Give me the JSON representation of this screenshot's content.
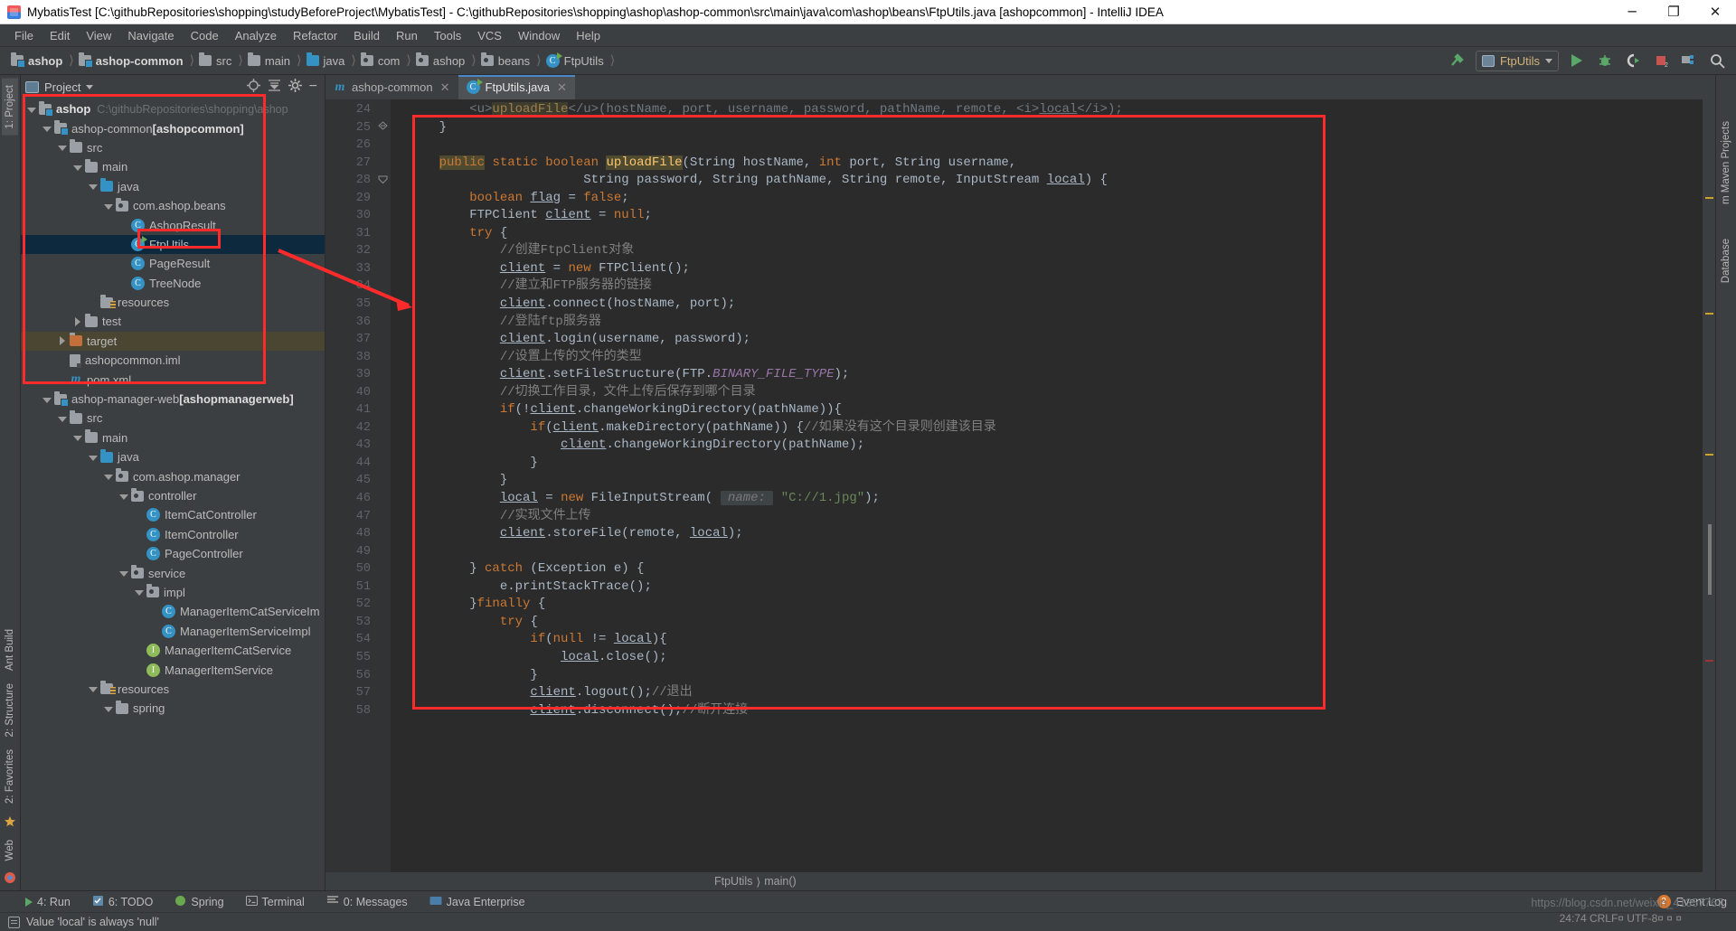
{
  "window": {
    "title": "MybatisTest [C:\\githubRepositories\\shopping\\studyBeforeProject\\MybatisTest] - C:\\githubRepositories\\shopping\\ashop\\ashop-common\\src\\main\\java\\com\\ashop\\beans\\FtpUtils.java [ashopcommon] - IntelliJ IDEA",
    "minimize": "─",
    "maximize": "❐",
    "close": "✕"
  },
  "menu": [
    "File",
    "Edit",
    "View",
    "Navigate",
    "Code",
    "Analyze",
    "Refactor",
    "Build",
    "Run",
    "Tools",
    "VCS",
    "Window",
    "Help"
  ],
  "navbar": {
    "crumbs": [
      {
        "label": "ashop",
        "icon": "module-folder-icon",
        "bold": true
      },
      {
        "label": "ashop-common",
        "icon": "module-folder-icon",
        "bold": true
      },
      {
        "label": "src",
        "icon": "folder-icon",
        "bold": false
      },
      {
        "label": "main",
        "icon": "folder-icon",
        "bold": false
      },
      {
        "label": "java",
        "icon": "source-folder-icon",
        "bold": false
      },
      {
        "label": "com",
        "icon": "package-icon",
        "bold": false
      },
      {
        "label": "ashop",
        "icon": "package-icon",
        "bold": false
      },
      {
        "label": "beans",
        "icon": "package-icon",
        "bold": false
      },
      {
        "label": "FtpUtils",
        "icon": "class-icon",
        "bold": false
      }
    ],
    "run_config": "FtpUtils",
    "icons": [
      "build-hammer-icon",
      "run-icon",
      "debug-icon",
      "run-coverage-icon",
      "stop-icon",
      "project-structure-icon",
      "search-icon"
    ]
  },
  "left_strips": {
    "top": [
      "1: Project",
      "Ant Build"
    ],
    "bottom": [
      "2: Structure",
      "2: Favorites",
      "Web"
    ],
    "right": [
      "m Maven Projects",
      "Database"
    ]
  },
  "project_panel": {
    "title": "Project",
    "tools": [
      "locate-icon",
      "collapse-all-icon",
      "settings-gear-icon",
      "hide-icon"
    ],
    "tree": [
      {
        "indent": 0,
        "twist": "open",
        "icon": "module-folder-icon",
        "label": "ashop",
        "bold": true,
        "path": "C:\\githubRepositories\\shopping\\ashop"
      },
      {
        "indent": 1,
        "twist": "open",
        "icon": "module-folder-icon",
        "label": "ashop-common ",
        "module": "[ashopcommon]"
      },
      {
        "indent": 2,
        "twist": "open",
        "icon": "folder-icon",
        "label": "src"
      },
      {
        "indent": 3,
        "twist": "open",
        "icon": "folder-icon",
        "label": "main"
      },
      {
        "indent": 4,
        "twist": "open",
        "icon": "source-folder-icon",
        "label": "java"
      },
      {
        "indent": 5,
        "twist": "open",
        "icon": "package-icon",
        "label": "com.ashop.beans"
      },
      {
        "indent": 6,
        "twist": "none",
        "icon": "class-icon",
        "label": "AshopResult"
      },
      {
        "indent": 6,
        "twist": "none",
        "icon": "runnable-class-icon",
        "label": "FtpUtils",
        "selected": true
      },
      {
        "indent": 6,
        "twist": "none",
        "icon": "class-icon",
        "label": "PageResult"
      },
      {
        "indent": 6,
        "twist": "none",
        "icon": "class-icon",
        "label": "TreeNode"
      },
      {
        "indent": 4,
        "twist": "none",
        "icon": "resources-folder-icon",
        "label": "resources"
      },
      {
        "indent": 3,
        "twist": "closed",
        "icon": "folder-icon",
        "label": "test"
      },
      {
        "indent": 2,
        "twist": "closed",
        "icon": "target-folder-icon",
        "label": "target",
        "highlight": true
      },
      {
        "indent": 2,
        "twist": "none",
        "icon": "iml-file-icon",
        "label": "ashopcommon.iml"
      },
      {
        "indent": 2,
        "twist": "none",
        "icon": "maven-pom-icon",
        "label": "pom.xml"
      },
      {
        "indent": 1,
        "twist": "open",
        "icon": "module-folder-icon",
        "label": "ashop-manager-web ",
        "module": "[ashopmanagerweb]"
      },
      {
        "indent": 2,
        "twist": "open",
        "icon": "folder-icon",
        "label": "src"
      },
      {
        "indent": 3,
        "twist": "open",
        "icon": "folder-icon",
        "label": "main"
      },
      {
        "indent": 4,
        "twist": "open",
        "icon": "source-folder-icon",
        "label": "java"
      },
      {
        "indent": 5,
        "twist": "open",
        "icon": "package-icon",
        "label": "com.ashop.manager"
      },
      {
        "indent": 6,
        "twist": "open",
        "icon": "package-icon",
        "label": "controller"
      },
      {
        "indent": 7,
        "twist": "none",
        "icon": "class-icon",
        "label": "ItemCatController"
      },
      {
        "indent": 7,
        "twist": "none",
        "icon": "class-icon",
        "label": "ItemController"
      },
      {
        "indent": 7,
        "twist": "none",
        "icon": "class-icon",
        "label": "PageController"
      },
      {
        "indent": 6,
        "twist": "open",
        "icon": "package-icon",
        "label": "service"
      },
      {
        "indent": 7,
        "twist": "open",
        "icon": "package-icon",
        "label": "impl"
      },
      {
        "indent": 8,
        "twist": "none",
        "icon": "class-icon",
        "label": "ManagerItemCatServiceIm"
      },
      {
        "indent": 8,
        "twist": "none",
        "icon": "class-icon",
        "label": "ManagerItemServiceImpl"
      },
      {
        "indent": 7,
        "twist": "none",
        "icon": "interface-icon",
        "label": "ManagerItemCatService"
      },
      {
        "indent": 7,
        "twist": "none",
        "icon": "interface-icon",
        "label": "ManagerItemService"
      },
      {
        "indent": 4,
        "twist": "open",
        "icon": "resources-folder-icon",
        "label": "resources"
      },
      {
        "indent": 5,
        "twist": "open",
        "icon": "folder-icon",
        "label": "spring"
      }
    ]
  },
  "editor": {
    "tabs": [
      {
        "label": "ashop-common",
        "icon": "maven-pom-icon",
        "active": false
      },
      {
        "label": "FtpUtils.java",
        "icon": "runnable-class-icon",
        "active": true
      }
    ],
    "first_line_number": 24,
    "lines": [
      {
        "n": 24,
        "html": "        <u>uploadFile</u>(hostName, port, username, password, pathName, remote, <i>local</i>);",
        "clipped": true
      },
      {
        "n": 25,
        "html": "    }",
        "fold": "end"
      },
      {
        "n": 26,
        "html": ""
      },
      {
        "n": 27,
        "html": "    public static boolean uploadFile(String hostName, int port, String username,"
      },
      {
        "n": 28,
        "html": "                       String password, String pathName, String remote, InputStream local) {",
        "fold": "start"
      },
      {
        "n": 29,
        "html": "        boolean flag = false;"
      },
      {
        "n": 30,
        "html": "        FTPClient client = null;"
      },
      {
        "n": 31,
        "html": "        try {"
      },
      {
        "n": 32,
        "html": "            //创建FtpClient对象"
      },
      {
        "n": 33,
        "html": "            client = new FTPClient();"
      },
      {
        "n": 34,
        "html": "            //建立和FTP服务器的链接"
      },
      {
        "n": 35,
        "html": "            client.connect(hostName, port);"
      },
      {
        "n": 36,
        "html": "            //登陆ftp服务器"
      },
      {
        "n": 37,
        "html": "            client.login(username, password);"
      },
      {
        "n": 38,
        "html": "            //设置上传的文件的类型"
      },
      {
        "n": 39,
        "html": "            client.setFileStructure(FTP.BINARY_FILE_TYPE);"
      },
      {
        "n": 40,
        "html": "            //切换工作目录，文件上传后保存到哪个目录"
      },
      {
        "n": 41,
        "html": "            if(!client.changeWorkingDirectory(pathName)){"
      },
      {
        "n": 42,
        "html": "                if(client.makeDirectory(pathName)) {//如果没有这个目录则创建该目录"
      },
      {
        "n": 43,
        "html": "                    client.changeWorkingDirectory(pathName);"
      },
      {
        "n": 44,
        "html": "                }"
      },
      {
        "n": 45,
        "html": "            }"
      },
      {
        "n": 46,
        "html": "            local = new FileInputStream( name: \"C://1.jpg\");"
      },
      {
        "n": 47,
        "html": "            //实现文件上传"
      },
      {
        "n": 48,
        "html": "            client.storeFile(remote, local);"
      },
      {
        "n": 49,
        "html": ""
      },
      {
        "n": 50,
        "html": "        } catch (Exception e) {"
      },
      {
        "n": 51,
        "html": "            e.printStackTrace();"
      },
      {
        "n": 52,
        "html": "        }finally {"
      },
      {
        "n": 53,
        "html": "            try {"
      },
      {
        "n": 54,
        "html": "                if(null != local){"
      },
      {
        "n": 55,
        "html": "                    local.close();"
      },
      {
        "n": 56,
        "html": "                }"
      },
      {
        "n": 57,
        "html": "                client.logout();//退出"
      },
      {
        "n": 58,
        "html": "                client.disconnect();//断开连接"
      }
    ],
    "breadcrumb": [
      "FtpUtils",
      "main()"
    ]
  },
  "bottom_bar": {
    "items": [
      {
        "label": "4: Run",
        "icon": "run-icon",
        "mnemonic": "4"
      },
      {
        "label": "6: TODO",
        "icon": "todo-icon",
        "mnemonic": "6"
      },
      {
        "label": "Spring",
        "icon": "spring-icon"
      },
      {
        "label": "Terminal",
        "icon": "terminal-icon"
      },
      {
        "label": "0: Messages",
        "icon": "messages-icon",
        "mnemonic": "0"
      },
      {
        "label": "Java Enterprise",
        "icon": "java-ee-icon"
      }
    ],
    "event_log": "Event Log",
    "event_log_count": "2"
  },
  "status_bar": {
    "message": "Value 'local' is always 'null'"
  },
  "watermarks": {
    "url": "https://blog.csdn.net/weixin_41357767",
    "caret": "24:74  CRLF¤  UTF-8¤  ¤  ¤"
  },
  "colors": {
    "accent_red": "#ff2b2b",
    "panel_bg": "#3c3f41",
    "editor_bg": "#2b2b2b",
    "selection_bg": "#0d293e",
    "keyword": "#cc7832",
    "method": "#ffc66d",
    "comment": "#808080",
    "string": "#6a8759",
    "static_field": "#9876aa"
  }
}
